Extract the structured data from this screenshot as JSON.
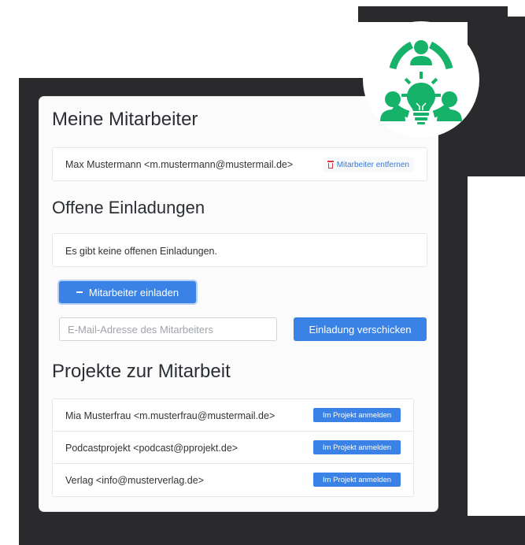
{
  "colors": {
    "accent": "#3b82e6",
    "danger": "#dc3545",
    "logo_green": "#17b26a"
  },
  "sections": {
    "members_title": "Meine Mitarbeiter",
    "invites_title": "Offene Einladungen",
    "projects_title": "Projekte zur Mitarbeit"
  },
  "members": [
    {
      "name": "Max Mustermann <m.mustermann@mustermail.de>",
      "action": "Mitarbeiter entfernen"
    }
  ],
  "invites": {
    "empty_text": "Es gibt keine offenen Einladungen."
  },
  "invite_form": {
    "toggle_label": "Mitarbeiter einladen",
    "email_placeholder": "E-Mail-Adresse des Mitarbeiters",
    "send_label": "Einladung verschicken"
  },
  "projects": [
    {
      "name": "Mia Musterfrau <m.musterfrau@mustermail.de>",
      "action": "Im Projekt anmelden"
    },
    {
      "name": "Podcastprojekt <podcast@pprojekt.de>",
      "action": "Im Projekt anmelden"
    },
    {
      "name": "Verlag <info@musterverlag.de>",
      "action": "Im Projekt anmelden"
    }
  ],
  "logo": {
    "icon": "team-idea-lightbulb-icon"
  }
}
